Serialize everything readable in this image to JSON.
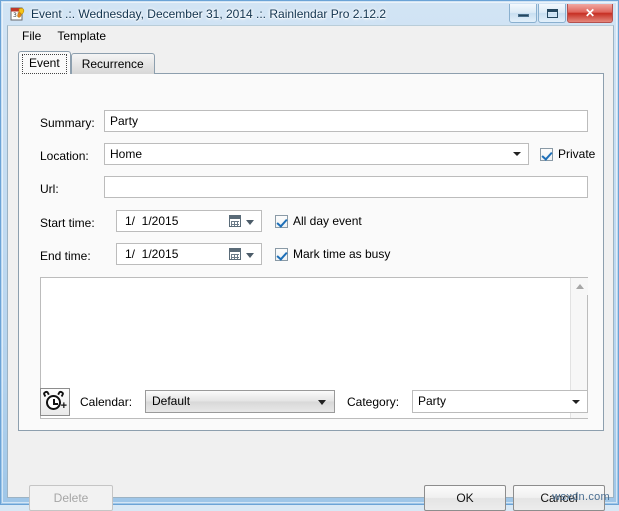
{
  "window": {
    "title": "Event .:. Wednesday, December 31, 2014 .:. Rainlendar Pro 2.12.2",
    "icon": "rainlendar-app-icon",
    "controls": {
      "minimize": "minimize-button",
      "maximize": "maximize-button",
      "close_glyph": "✕"
    },
    "frame_color": "#9ec6e8",
    "title_color": "#12344f"
  },
  "menubar": {
    "items": [
      {
        "label": "File"
      },
      {
        "label": "Template"
      }
    ]
  },
  "tabs": [
    {
      "label": "Event",
      "selected": true
    },
    {
      "label": "Recurrence",
      "selected": false
    }
  ],
  "form": {
    "summary": {
      "label": "Summary:",
      "value": "Party",
      "placeholder": ""
    },
    "location": {
      "label": "Location:",
      "value": "Home",
      "placeholder": ""
    },
    "url": {
      "label": "Url:",
      "value": "",
      "placeholder": ""
    },
    "private": {
      "label": "Private",
      "checked": true
    },
    "start_time": {
      "label": "Start time:",
      "value": "1/  1/2015"
    },
    "end_time": {
      "label": "End time:",
      "value": "1/  1/2015"
    },
    "all_day": {
      "label": "All day event",
      "checked": true
    },
    "mark_busy": {
      "label": "Mark time as busy",
      "checked": true
    },
    "description": {
      "value": ""
    }
  },
  "bottom": {
    "alarm_button": "add-alarm-button",
    "calendar": {
      "label": "Calendar:",
      "value": "Default"
    },
    "category": {
      "label": "Category:",
      "value": "Party"
    }
  },
  "dialog_buttons": {
    "delete": {
      "label": "Delete",
      "enabled": false
    },
    "ok": {
      "label": "OK",
      "enabled": true
    },
    "cancel": {
      "label": "Cancel",
      "enabled": true
    }
  },
  "watermark": "wsxdn.com"
}
